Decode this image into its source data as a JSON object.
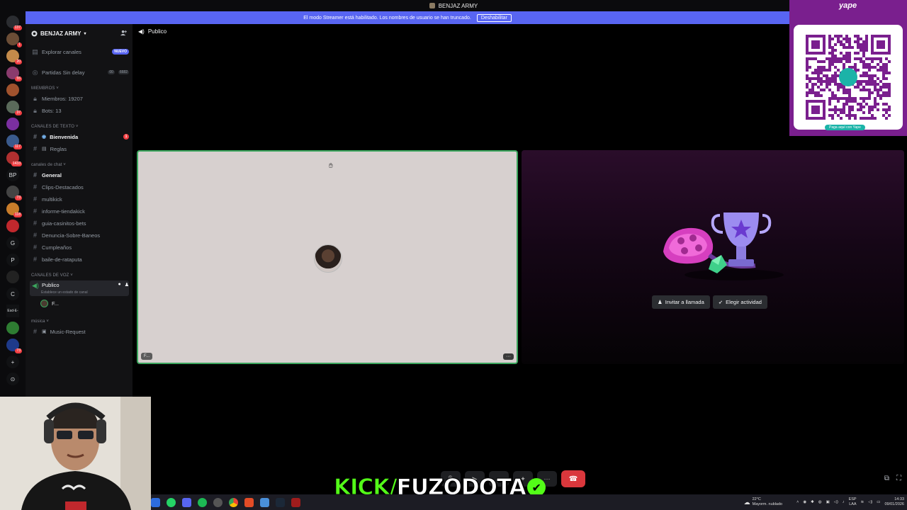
{
  "window": {
    "title": "BENJAZ ARMY"
  },
  "banner": {
    "text": "El modo Streamer está habilitado. Los nombres de usuario se han truncado.",
    "button": "Deshabilitar"
  },
  "guilds": [
    {
      "label": "",
      "badge": "137",
      "color": "#2b2d31"
    },
    {
      "label": "",
      "badge": "1",
      "color": "#6b4d36"
    },
    {
      "label": "",
      "badge": "20",
      "color": "#c38a4a"
    },
    {
      "label": "",
      "badge": "55",
      "color": "#8a3b6d"
    },
    {
      "label": "",
      "badge": "",
      "color": "#a0522d"
    },
    {
      "label": "",
      "badge": "37",
      "color": "#5a6a5a"
    },
    {
      "label": "",
      "badge": "",
      "color": "#7b2fa0"
    },
    {
      "label": "",
      "badge": "117",
      "color": "#3a5a8c"
    },
    {
      "label": "",
      "badge": "1433",
      "color": "#b03030"
    },
    {
      "label": "BP",
      "badge": "",
      "color": "#111214"
    },
    {
      "label": "",
      "badge": "73",
      "color": "#444"
    },
    {
      "label": "",
      "badge": "118",
      "color": "#c87c2a"
    },
    {
      "label": "",
      "badge": "",
      "color": "#c0282d"
    },
    {
      "label": "G",
      "badge": "",
      "color": "#111214"
    },
    {
      "label": "P",
      "badge": "",
      "color": "#111214"
    },
    {
      "label": "",
      "badge": "",
      "color": "#222"
    },
    {
      "label": "C",
      "badge": "",
      "color": "#111214"
    },
    {
      "label": "Esd-E-",
      "badge": "",
      "color": "#111214"
    },
    {
      "label": "",
      "badge": "",
      "color": "#2e7d32"
    },
    {
      "label": "",
      "badge": "73",
      "color": "#1e3a8a"
    },
    {
      "label": "+",
      "badge": "",
      "color": "#111214"
    },
    {
      "label": "⊙",
      "badge": "",
      "color": "#111214"
    }
  ],
  "sidebar": {
    "server_name": "BENJAZ ARMY",
    "explore": {
      "label": "Explorar canales",
      "pill": "NUEVO"
    },
    "partidas": {
      "label": "Partidas Sin delay",
      "count_a": "00",
      "count_b": "6682"
    },
    "cat_members": "MIEMBROS",
    "members": "Miembros: 19207",
    "bots": "Bots: 13",
    "cat_text": "CANALES DE TEXTO",
    "text_channels": [
      {
        "name": "Bienvenida",
        "badge": "1"
      },
      {
        "name": "Reglas",
        "badge": ""
      }
    ],
    "cat_chat": "canales de chat",
    "chat_channels": [
      "General",
      "Clips-Destacados",
      "multikick",
      "informe-tiendakick",
      "guia-casinitos-bets",
      "Denuncia-Sobre-Baneos",
      "Cumpleaños",
      "baile-de-rataputa"
    ],
    "cat_voice": "CANALES DE VOZ",
    "voice_channel": {
      "name": "Publico",
      "status": "Establece un estado de canal",
      "member": "F..."
    },
    "cat_music": "música",
    "music_channel": "Music-Request"
  },
  "header": {
    "channel": "Publico"
  },
  "call": {
    "user_tag": "F...",
    "more": "···",
    "invite": "Invitar a llamada",
    "activity": "Elegir actividad"
  },
  "qr": {
    "brand": "yape",
    "footer": "Paga aquí con Yape"
  },
  "kick": {
    "prefix": "KICK/",
    "name": "FUZODOTA"
  },
  "taskbar": {
    "temp": "22°C",
    "weather": "Mayorm. nublado",
    "lang_a": "ESP",
    "lang_b": "LAA",
    "time": "14:33",
    "date": "09/01/2026"
  }
}
